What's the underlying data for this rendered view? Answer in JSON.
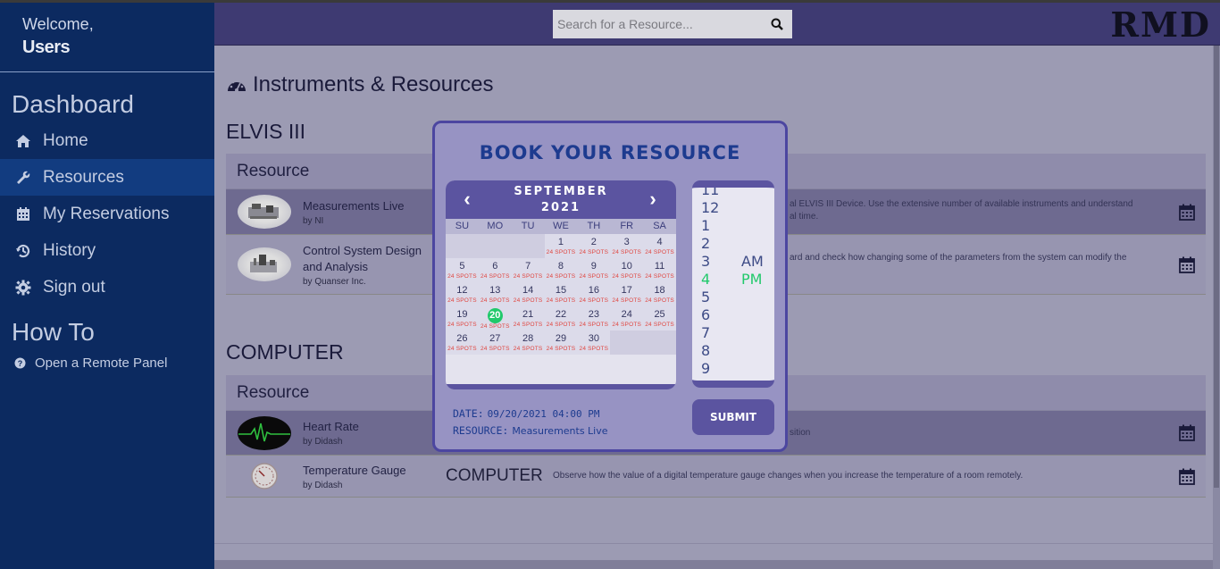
{
  "sidebar": {
    "welcome": "Welcome,",
    "user": "Users",
    "dashboard_heading": "Dashboard",
    "items": [
      {
        "label": "Home",
        "icon": "home-icon"
      },
      {
        "label": "Resources",
        "icon": "wrench-icon",
        "active": true
      },
      {
        "label": "My Reservations",
        "icon": "calendar-icon"
      },
      {
        "label": "History",
        "icon": "history-icon"
      },
      {
        "label": "Sign out",
        "icon": "gear-icon"
      }
    ],
    "howto_heading": "How To",
    "howto_items": [
      {
        "label": "Open a Remote Panel",
        "icon": "question-circle-icon"
      }
    ]
  },
  "topbar": {
    "search_placeholder": "Search for a Resource...",
    "logo": "RMD"
  },
  "main": {
    "title": "Instruments & Resources",
    "sections": [
      {
        "title": "ELVIS III",
        "panel_header": "Resource",
        "rows": [
          {
            "name": "Measurements Live",
            "by": "by NI",
            "desc": "al ELVIS III Device. Use the extensive number of available instruments and understand",
            "desc2": "al time."
          },
          {
            "name": "Control System Design and Analysis",
            "by": "by Quanser Inc.",
            "desc": "ard and check how changing some of the parameters from the system can modify the",
            "desc2": ""
          }
        ]
      },
      {
        "title": "COMPUTER",
        "panel_header": "Resource",
        "rows": [
          {
            "name": "Heart Rate",
            "by": "by Didash",
            "category": "",
            "desc": "sition"
          },
          {
            "name": "Temperature Gauge",
            "by": "by Didash",
            "category": "COMPUTER",
            "desc": "Observe how the value of a digital temperature gauge changes when you increase the temperature of a room remotely."
          }
        ]
      }
    ]
  },
  "modal": {
    "title": "BOOK YOUR RESOURCE",
    "month": "SEPTEMBER",
    "year": "2021",
    "prev": "‹",
    "next": "›",
    "weekdays": [
      "SU",
      "MO",
      "TU",
      "WE",
      "TH",
      "FR",
      "SA"
    ],
    "first_weekday_index": 3,
    "days_in_month": 30,
    "selected_day": 20,
    "spots_label": "24 SPOTS",
    "hours": [
      "11",
      "12",
      "1",
      "2",
      "3",
      "4",
      "5",
      "6",
      "7",
      "8",
      "9"
    ],
    "selected_hour": "4",
    "ampm": [
      "AM",
      "PM"
    ],
    "selected_ampm": "PM",
    "date_label": "DATE:",
    "date_value": "09/20/2021 04:00 PM",
    "resource_label": "RESOURCE:",
    "resource_value": "Measurements Live",
    "submit": "SUBMIT"
  },
  "colors": {
    "sidebar_bg": "#0c2a60",
    "topbar_bg": "#3e3a72",
    "modal_accent": "#5b54a0",
    "selected_green": "#21c96b",
    "spots_red": "#e0453f",
    "title_blue": "#1d3b8f"
  }
}
